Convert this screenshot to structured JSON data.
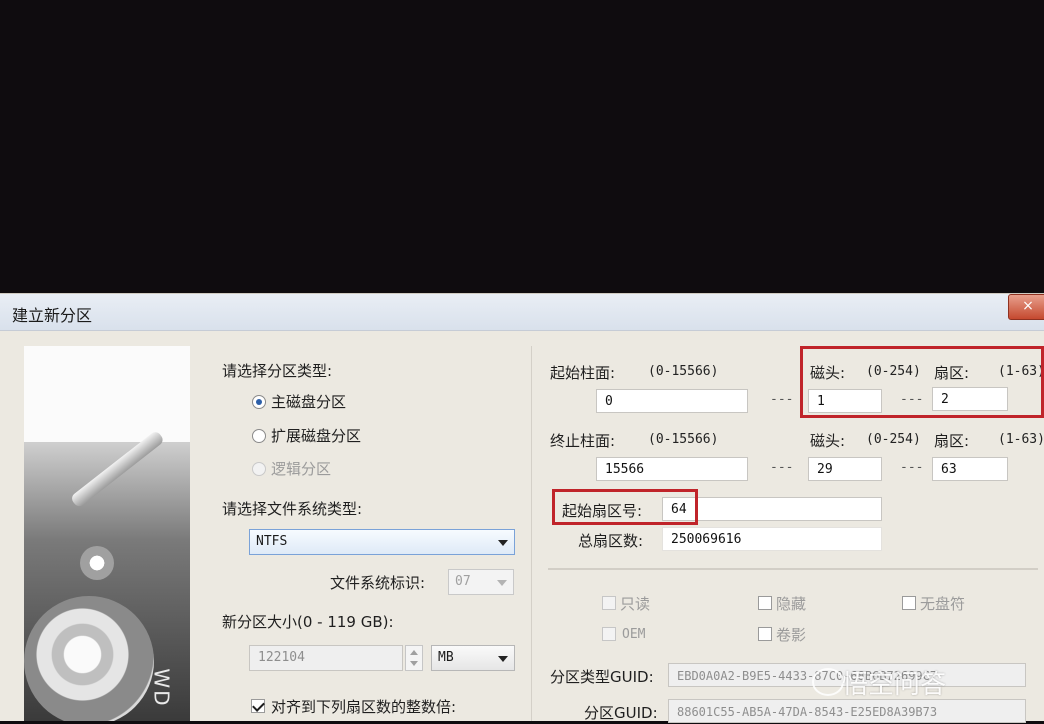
{
  "dialog": {
    "title": "建立新分区",
    "close_label": "×"
  },
  "left": {
    "partition_type_heading": "请选择分区类型:",
    "partition_types": [
      "主磁盘分区",
      "扩展磁盘分区",
      "逻辑分区"
    ],
    "fs_type_heading": "请选择文件系统类型:",
    "fs_type_value": "NTFS",
    "fs_id_label": "文件系统标识:",
    "fs_id_value": "07",
    "size_label": "新分区大小(0 - 119 GB):",
    "size_value": "122104",
    "size_unit": "MB",
    "align_label": "对齐到下列扇区数的整数倍:"
  },
  "right": {
    "start_cyl_label": "起始柱面:",
    "start_cyl_range": "(0-15566)",
    "start_cyl_value": "0",
    "start_head_label": "磁头:",
    "start_head_range": "(0-254)",
    "start_head_value": "1",
    "start_sector_label": "扇区:",
    "start_sector_range": "(1-63)",
    "start_sector_value": "2",
    "end_cyl_label": "终止柱面:",
    "end_cyl_range": "(0-15566)",
    "end_cyl_value": "15566",
    "end_head_label": "磁头:",
    "end_head_range": "(0-254)",
    "end_head_value": "29",
    "end_sector_label": "扇区:",
    "end_sector_range": "(1-63)",
    "end_sector_value": "63",
    "start_lba_label": "起始扇区号:",
    "start_lba_value": "64",
    "total_sectors_label": "总扇区数:",
    "total_sectors_value": "250069616",
    "dash": "---",
    "attrs": [
      "只读",
      "隐藏",
      "无盘符",
      "OEM",
      "卷影"
    ],
    "type_guid_label": "分区类型GUID:",
    "type_guid_value": "EBD0A0A2-B9E5-4433-87C0-68B6B72699C7",
    "part_guid_label": "分区GUID:",
    "part_guid_value": "88601C55-AB5A-47DA-8543-E25ED8A39B73"
  },
  "image": {
    "label": "WD"
  },
  "watermark": {
    "text": "悟空问答"
  }
}
